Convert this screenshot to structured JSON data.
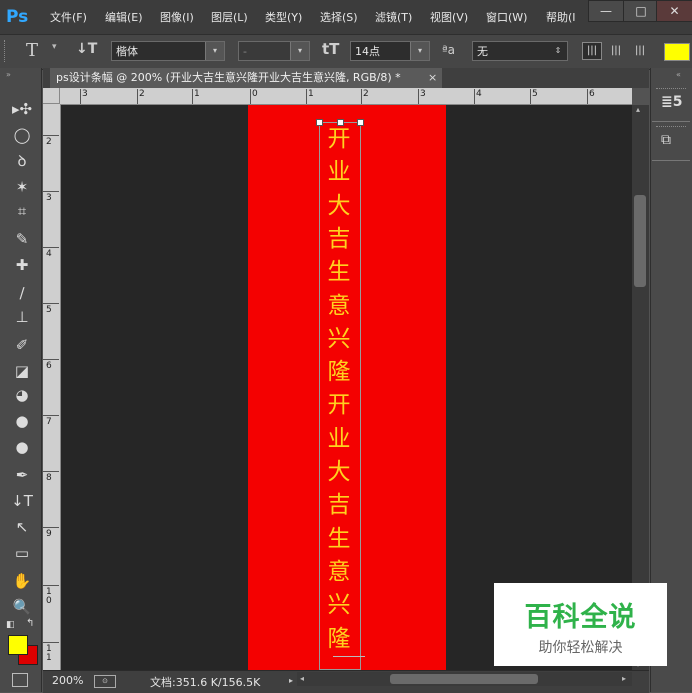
{
  "app": {
    "logo_text": "Ps"
  },
  "menu": {
    "items": [
      "文件(F)",
      "编辑(E)",
      "图像(I)",
      "图层(L)",
      "类型(Y)",
      "选择(S)",
      "滤镜(T)",
      "视图(V)",
      "窗口(W)",
      "帮助(I"
    ]
  },
  "window_controls": {
    "minimize": "—",
    "maximize": "□",
    "close": "✕"
  },
  "options_bar": {
    "tool_icon": "T",
    "orientation_icon": "↓T",
    "font_family": "楷体",
    "font_style": "-",
    "size_icon": "tT",
    "font_size": "14点",
    "aa_icon": "ªa",
    "antialias": "无",
    "text_color": "#ffff00"
  },
  "document": {
    "tab_title": "ps设计条幅 @ 200% (开业大吉生意兴隆开业大吉生意兴隆, RGB/8) *",
    "tab_close": "×",
    "canvas_color": "#f40101",
    "text_color": "#ffd21f",
    "text_chars": [
      "开",
      "业",
      "大",
      "吉",
      "生",
      "意",
      "兴",
      "隆",
      "开",
      "业",
      "大",
      "吉",
      "生",
      "意",
      "兴",
      "隆"
    ]
  },
  "rulers": {
    "horizontal": [
      "3",
      "2",
      "1",
      "0",
      "1",
      "2",
      "3",
      "4",
      "5",
      "6"
    ],
    "vertical": [
      "2",
      "3",
      "4",
      "5",
      "6",
      "7",
      "8",
      "9",
      "1 0",
      "1 1"
    ]
  },
  "tools": [
    {
      "name": "move-tool",
      "icon": "move-icon"
    },
    {
      "name": "marquee-tool",
      "icon": "elliptical-marquee-icon"
    },
    {
      "name": "lasso-tool",
      "icon": "lasso-icon"
    },
    {
      "name": "magic-wand-tool",
      "icon": "magic-wand-icon"
    },
    {
      "name": "crop-tool",
      "icon": "crop-icon"
    },
    {
      "name": "eyedropper-tool",
      "icon": "eyedropper-icon"
    },
    {
      "name": "healing-brush-tool",
      "icon": "bandage-icon"
    },
    {
      "name": "brush-tool",
      "icon": "brush-icon"
    },
    {
      "name": "stamp-tool",
      "icon": "stamp-icon"
    },
    {
      "name": "history-brush-tool",
      "icon": "history-brush-icon"
    },
    {
      "name": "eraser-tool",
      "icon": "eraser-icon"
    },
    {
      "name": "paint-bucket-tool",
      "icon": "paint-bucket-icon"
    },
    {
      "name": "blur-tool",
      "icon": "blur-drop-icon"
    },
    {
      "name": "dodge-tool",
      "icon": "dodge-icon"
    },
    {
      "name": "pen-tool",
      "icon": "pen-icon"
    },
    {
      "name": "type-tool",
      "icon": "vertical-type-icon"
    },
    {
      "name": "path-selection-tool",
      "icon": "arrow-icon"
    },
    {
      "name": "shape-tool",
      "icon": "rectangle-icon"
    },
    {
      "name": "hand-tool",
      "icon": "hand-icon"
    },
    {
      "name": "zoom-tool",
      "icon": "zoom-icon"
    }
  ],
  "tool_glyphs": [
    "▸✣",
    "◯",
    "ꝺ",
    "✶",
    "⌗",
    "✎",
    "✚",
    "∕",
    "⊥",
    "✐",
    "◪",
    "◕",
    "●",
    "●",
    "✒",
    "↓T",
    "↖",
    "▭",
    "✋",
    "🔍"
  ],
  "colors": {
    "foreground": "#ffff00",
    "background": "#dd0000"
  },
  "status": {
    "zoom": "200%",
    "doc_info": "文档:351.6 K/156.5K"
  },
  "watermark": {
    "title": "百科全说",
    "subtitle": "助你轻松解决"
  }
}
